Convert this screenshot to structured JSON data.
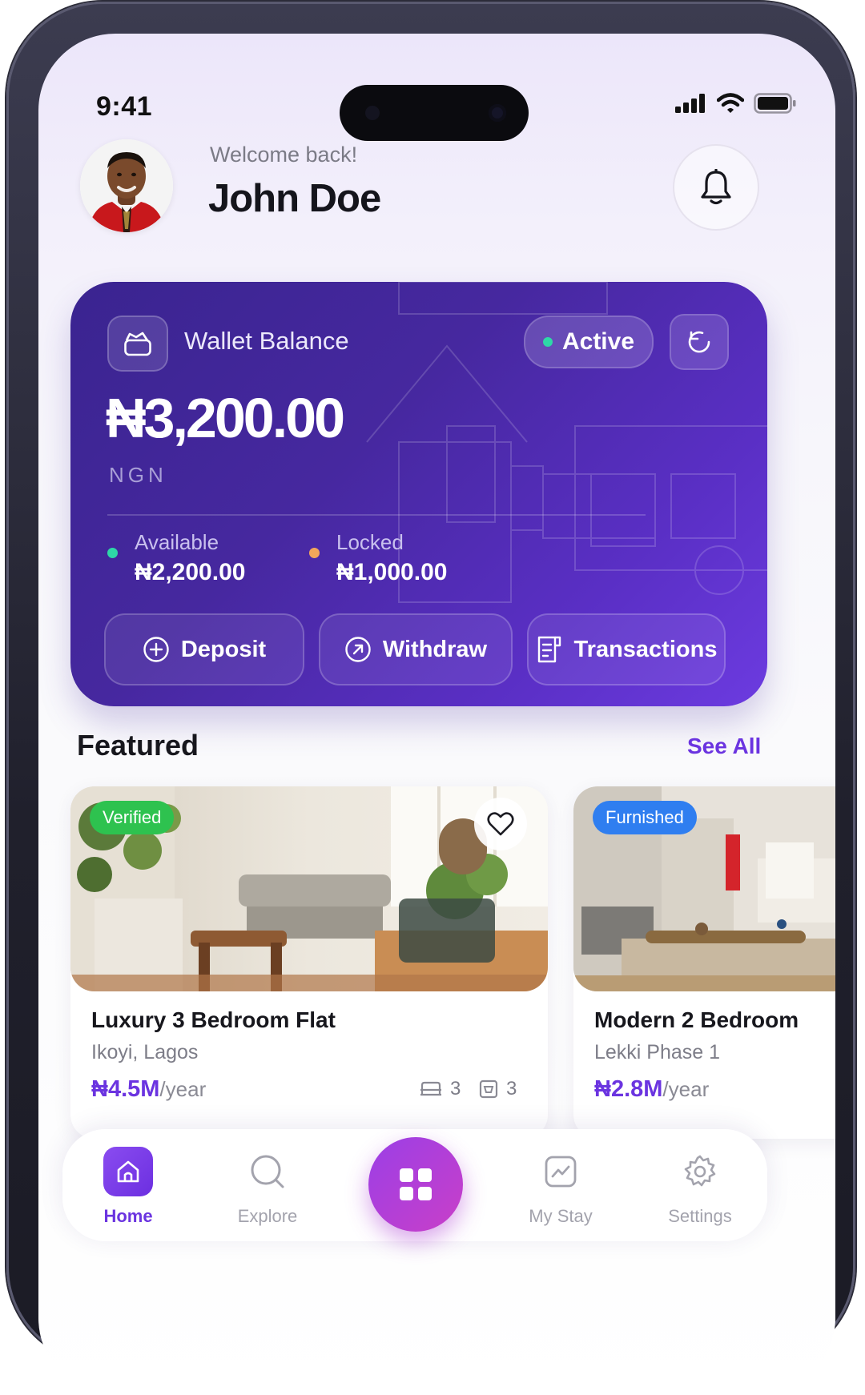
{
  "status_bar": {
    "time": "9:41"
  },
  "header": {
    "greeting": "Welcome back!",
    "username": "John Doe",
    "avatar_icon": "user-avatar-photo",
    "notification_icon": "bell-icon"
  },
  "wallet": {
    "title": "Wallet Balance",
    "status": "Active",
    "balance": "₦3,200.00",
    "currency": "NGN",
    "available_label": "Available",
    "available_value": "₦2,200.00",
    "locked_label": "Locked",
    "locked_value": "₦1,000.00",
    "actions": {
      "deposit": "Deposit",
      "withdraw": "Withdraw",
      "transactions": "Transactions"
    },
    "colors": {
      "card_start": "#3a2490",
      "card_end": "#6c3be0",
      "available_dot": "#2ed8a7",
      "locked_dot": "#f2a65a"
    }
  },
  "featured": {
    "title": "Featured",
    "see_all": "See All",
    "listings": [
      {
        "badge": "Verified",
        "name": "Luxury 3 Bedroom Flat",
        "location": "Ikoyi, Lagos",
        "price": "₦4.5M",
        "period": "/year",
        "beds": "3",
        "baths": "3"
      },
      {
        "badge": "Furnished",
        "name": "Modern 2 Bedroom",
        "location": "Lekki Phase 1",
        "price": "₦2.8M",
        "period": "/year"
      }
    ]
  },
  "nav": {
    "home": "Home",
    "explore": "Explore",
    "my_stay": "My Stay",
    "settings": "Settings"
  },
  "accent_color": "#6b34e0"
}
